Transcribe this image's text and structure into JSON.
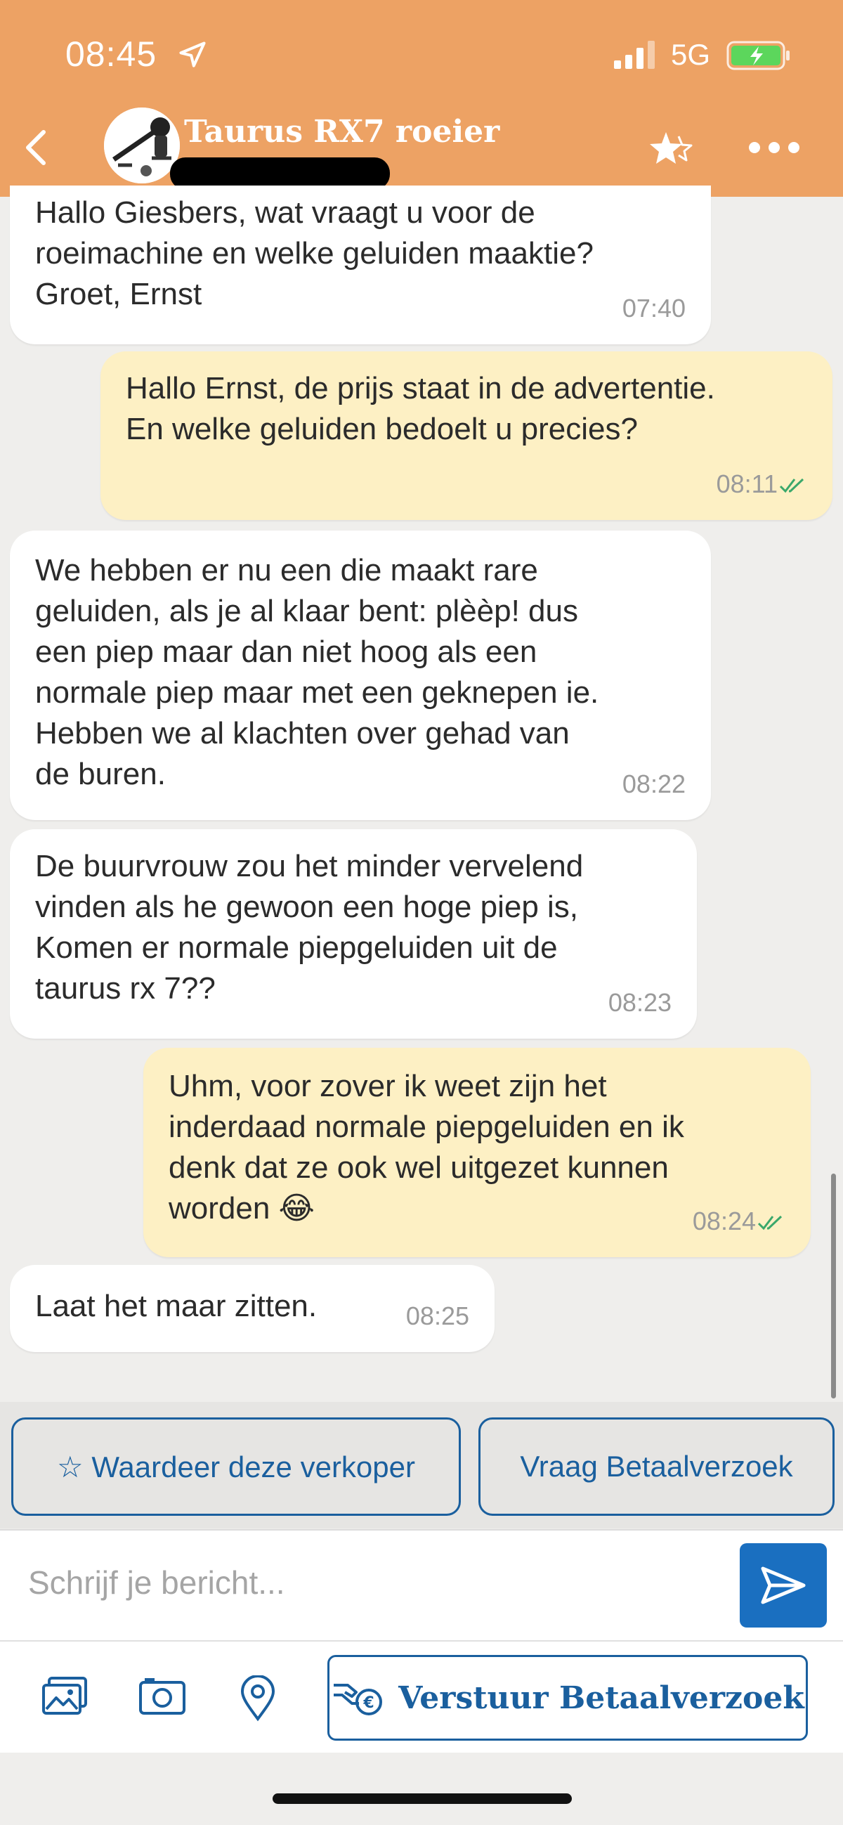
{
  "status_bar": {
    "time": "08:45",
    "network": "5G"
  },
  "header": {
    "title": "Taurus RX7 roeier"
  },
  "messages": [
    {
      "direction": "in",
      "text": "Hallo Giesbers, wat vraagt u voor de\nroeimachine en welke geluiden maaktie?\nGroet, Ernst",
      "time": "07:40"
    },
    {
      "direction": "out",
      "text": "Hallo Ernst, de prijs staat in de advertentie.\nEn welke geluiden bedoelt u precies?",
      "time": "08:11",
      "read": true
    },
    {
      "direction": "in",
      "text": "We hebben er nu een die maakt rare\ngeluiden, als je al klaar bent: plèèp! dus\neen piep maar dan niet hoog als een\nnormale piep maar met een geknepen ie.\nHebben we al klachten over gehad van\nde buren.",
      "time": "08:22"
    },
    {
      "direction": "in",
      "text": "De buurvrouw zou het minder vervelend\nvinden als he gewoon een hoge piep is,\nKomen er normale piepgeluiden uit de\ntaurus rx 7??",
      "time": "08:23"
    },
    {
      "direction": "out",
      "text": "Uhm, voor zover ik weet zijn het\ninderdaad normale piepgeluiden en ik\ndenk dat ze ook wel uitgezet kunnen\nworden 😂",
      "time": "08:24",
      "read": true
    },
    {
      "direction": "in",
      "text": "Laat het maar zitten.",
      "time": "08:25"
    }
  ],
  "actions": {
    "rate_seller": "☆ Waardeer deze verkoper",
    "request_payment": "Vraag Betaalverzoek"
  },
  "composer": {
    "placeholder": "Schrijf je bericht..."
  },
  "toolbar": {
    "icons": [
      "gallery-icon",
      "camera-icon",
      "location-pin-icon",
      "payment-hand-icon"
    ],
    "send_payment_request": "Verstuur Betaalverzoek"
  },
  "colors": {
    "header": "#eda264",
    "outgoing_bubble": "#fdf0c4",
    "incoming_bubble": "#ffffff",
    "accent": "#1a5f9e",
    "read_checks": "#3aa86b"
  }
}
